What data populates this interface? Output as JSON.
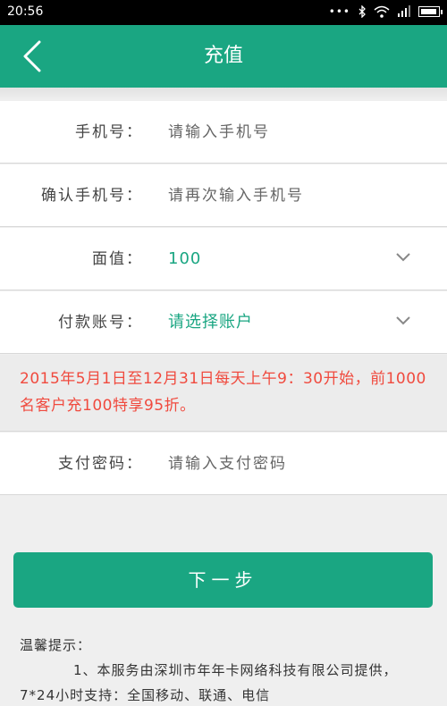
{
  "status_bar": {
    "time": "20:56",
    "dots": "•••"
  },
  "app_bar": {
    "title": "充值",
    "back_icon": "chevron-left-icon"
  },
  "form": {
    "phone": {
      "label": "手机号：",
      "placeholder": "请输入手机号"
    },
    "confirm_phone": {
      "label": "确认手机号：",
      "placeholder": "请再次输入手机号"
    },
    "amount": {
      "label": "面值：",
      "value": "100"
    },
    "account": {
      "label": "付款账号：",
      "value": "请选择账户"
    },
    "password": {
      "label": "支付密码：",
      "placeholder": "请输入支付密码"
    }
  },
  "promo": {
    "text": "2015年5月1日至12月31日每天上午9：30开始，前1000名客户充100特享95折。",
    "color": "#f04a3e"
  },
  "next_button": {
    "label": "下一步"
  },
  "notes": {
    "heading": "温馨提示：",
    "line1": "1、本服务由深圳市年年卡网络科技有限公司提供，7*24小时支持：全国移动、联通、电信"
  },
  "colors": {
    "accent": "#1aa682"
  }
}
